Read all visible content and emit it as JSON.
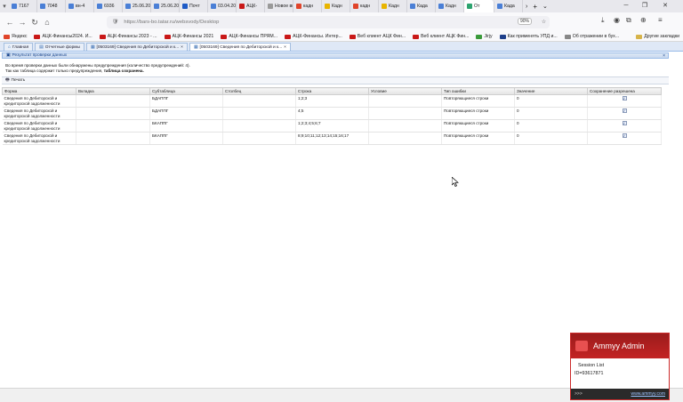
{
  "browser": {
    "tabs": [
      {
        "label": "7167",
        "color": "#4a7fd6"
      },
      {
        "label": "7048",
        "color": "#4a7fd6"
      },
      {
        "label": "вн-4",
        "color": "#4a7fd6"
      },
      {
        "label": "6936",
        "color": "#4a7fd6"
      },
      {
        "label": "25.06.202",
        "color": "#4a7fd6"
      },
      {
        "label": "25.06.202",
        "color": "#4a7fd6"
      },
      {
        "label": "Почт",
        "color": "#1e5bc6"
      },
      {
        "label": "03.04.202",
        "color": "#4a7fd6"
      },
      {
        "label": "АЦК-",
        "color": "#c91818"
      },
      {
        "label": "Новое вк",
        "color": "#999999"
      },
      {
        "label": "кадн",
        "color": "#e0442a"
      },
      {
        "label": "Кадн",
        "color": "#e8b400"
      },
      {
        "label": "кадн",
        "color": "#e0442a"
      },
      {
        "label": "Кадн",
        "color": "#e8b400"
      },
      {
        "label": "Када",
        "color": "#4a7fd6"
      },
      {
        "label": "Кадн",
        "color": "#4a7fd6"
      },
      {
        "label": "От",
        "color": "#2da36f"
      },
      {
        "label": "Када",
        "color": "#4a7fd6"
      }
    ],
    "url": "https://bars-bo.tatar.ru/websvody/Desktop",
    "zoom": "90%",
    "bookmarks": [
      {
        "label": "Яндекс",
        "color": "#e0442a"
      },
      {
        "label": "АЦК-Финансы2024. И...",
        "color": "#c91818"
      },
      {
        "label": "АЦК-Финансы 2023 - ...",
        "color": "#c91818"
      },
      {
        "label": "АЦК-Финансы 2021",
        "color": "#c91818"
      },
      {
        "label": "АЦК-Финансы ПРЯМ...",
        "color": "#c91818"
      },
      {
        "label": "АЦК-Финансы. Интер...",
        "color": "#c91818"
      },
      {
        "label": "Веб клиент АЦК Фин...",
        "color": "#c91818"
      },
      {
        "label": "Веб клиент АЦК Фин...",
        "color": "#c91818"
      },
      {
        "label": "Jirjy",
        "color": "#3a9a3a"
      },
      {
        "label": "Как применять УПД и...",
        "color": "#1e3f8a"
      },
      {
        "label": "Об отражении в бух...",
        "color": "#888888"
      }
    ],
    "other_bookmarks": "Другие закладки"
  },
  "app": {
    "tabs": [
      "Главная",
      "Отчетные формы",
      "[0503169] Сведения по Дебиторской и к...",
      "[0503169] Сведения по Дебиторской и к..."
    ],
    "panel_title": "Результат проверки данных",
    "message_line1": "Во время проверки данных были обнаружены предупреждения (количество предупреждений: 4).",
    "message_line2_prefix": "Так как таблица содержит только предупреждения, ",
    "message_line2_bold": "таблица сохранена.",
    "print_label": "Печать",
    "columns": [
      "Форма",
      "Вкладка",
      "Субтаблица",
      "Столбец",
      "Строка",
      "Условие",
      "Тип ошибки",
      "Значение",
      "Сохранение разрешена"
    ],
    "rows": [
      {
        "form": "Сведения по Дебиторской и кредиторской задолженности",
        "tab": "",
        "subtable": "БДАППГ",
        "column": "",
        "row": "1;2;3",
        "condition": "",
        "error_type": "Повторяющиеся строки",
        "value": "0",
        "allowed": "✓"
      },
      {
        "form": "Сведения по Дебиторской и кредиторской задолженности",
        "tab": "",
        "subtable": "БДАППГ",
        "column": "",
        "row": "4;5",
        "condition": "",
        "error_type": "Повторяющиеся строки",
        "value": "0",
        "allowed": "✓"
      },
      {
        "form": "Сведения по Дебиторской и кредиторской задолженности",
        "tab": "",
        "subtable": "БКАППГ",
        "column": "",
        "row": "1;2;3;4;5;6;7",
        "condition": "",
        "error_type": "Повторяющиеся строки",
        "value": "0",
        "allowed": "✓"
      },
      {
        "form": "Сведения по Дебиторской и кредиторской задолженности",
        "tab": "",
        "subtable": "БКАППГ",
        "column": "",
        "row": "8;9;10;11;12;13;14;15;16;17",
        "condition": "",
        "error_type": "Повторяющиеся строки",
        "value": "0",
        "allowed": "✓"
      }
    ]
  },
  "ammyy": {
    "title": "Ammyy Admin",
    "session_list": "Session List",
    "id": "ID=93617871",
    "footer_left": ">>>",
    "footer_link": "www.ammyy.com"
  }
}
